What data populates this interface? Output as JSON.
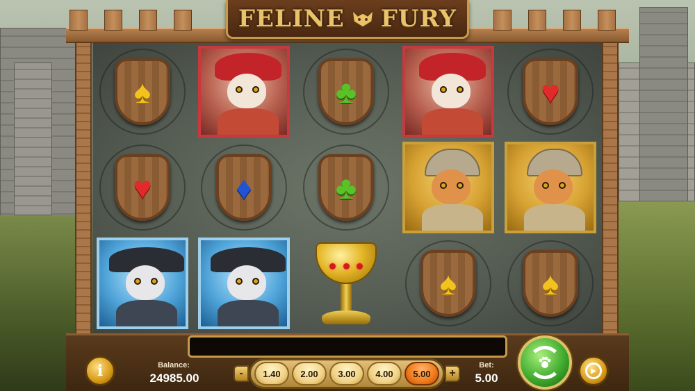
{
  "game": {
    "title_left": "FELINE",
    "title_right": "FURY"
  },
  "reels": {
    "grid": [
      [
        "spade",
        "noble-cat",
        "club",
        "noble-cat",
        "heart"
      ],
      [
        "heart",
        "diamond",
        "club",
        "knight-cat",
        "knight-cat"
      ],
      [
        "pirate-cat",
        "pirate-cat",
        "chalice",
        "spade",
        "spade"
      ]
    ]
  },
  "controls": {
    "balance_label": "Balance:",
    "balance_value": "24985.00",
    "bet_label": "Bet:",
    "bet_value": "5.00",
    "bet_options": [
      "1.40",
      "2.00",
      "3.00",
      "4.00",
      "5.00"
    ],
    "selected_bet": "5.00",
    "minus_label": "-",
    "plus_label": "+",
    "info_label": "i"
  },
  "icons": {
    "info": "info-icon",
    "spin": "spin-clover-icon",
    "autoplay": "autoplay-icon"
  },
  "colors": {
    "spin": "#3aa52a",
    "selected_chip": "#f07a1a",
    "frame": "#8a5c33"
  }
}
